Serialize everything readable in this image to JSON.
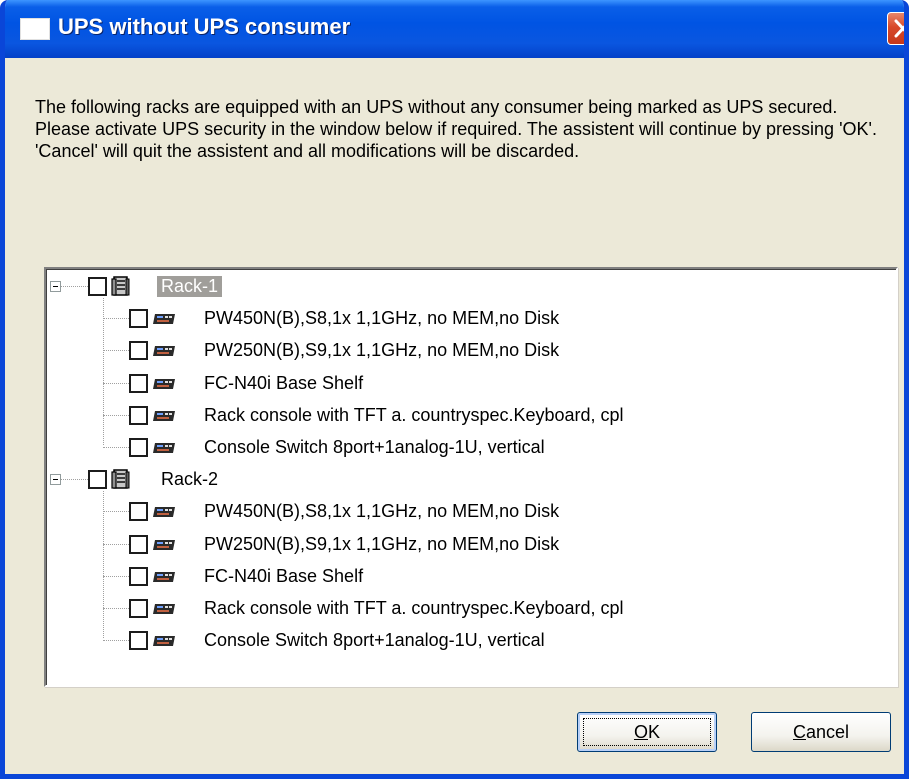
{
  "window": {
    "title": "UPS without UPS consumer"
  },
  "message": {
    "line1": "The following racks are equipped with an UPS without any consumer being marked as UPS secured.",
    "line2": "Please activate UPS security in the window below if required. The assistent will continue by pressing 'OK'. 'Cancel' will quit the assistent and all modifications will be discarded."
  },
  "tree": {
    "racks": [
      {
        "label": "Rack-1",
        "selected": true,
        "items": [
          "PW450N(B),S8,1x 1,1GHz, no MEM,no Disk",
          "PW250N(B),S9,1x 1,1GHz, no MEM,no Disk",
          "FC-N40i Base Shelf",
          "Rack console with TFT a. countryspec.Keyboard, cpl",
          "Console Switch 8port+1analog-1U, vertical"
        ]
      },
      {
        "label": "Rack-2",
        "selected": false,
        "items": [
          "PW450N(B),S8,1x 1,1GHz, no MEM,no Disk",
          "PW250N(B),S9,1x 1,1GHz, no MEM,no Disk",
          "FC-N40i Base Shelf",
          "Rack console with TFT a. countryspec.Keyboard, cpl",
          "Console Switch 8port+1analog-1U, vertical"
        ]
      }
    ]
  },
  "buttons": {
    "ok_mnemonic": "O",
    "ok_rest": "K",
    "cancel_mnemonic": "C",
    "cancel_rest": "ancel"
  },
  "colors": {
    "titlebar": "#0054e3",
    "dialog_bg": "#ece9d8",
    "selection": "#a09e9a",
    "close_button": "#d8492a"
  },
  "icons": {
    "rack": "rack-icon",
    "device": "server-device-icon",
    "close": "close-icon",
    "window": "window-icon"
  }
}
